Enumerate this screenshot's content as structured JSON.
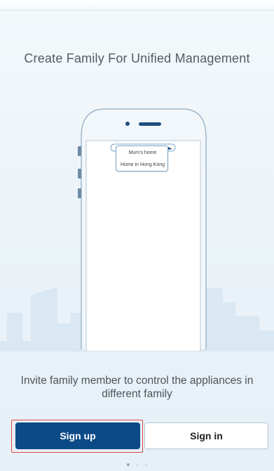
{
  "onboarding": {
    "headline": "Create Family For Unified Management",
    "popup_items": [
      "Mum's home",
      "Home in Hong Kong"
    ],
    "caption": "Invite family member to control the appliances in different family",
    "sign_up_label": "Sign up",
    "sign_in_label": "Sign in",
    "pager": {
      "count": 3,
      "active_index": 0
    }
  },
  "colors": {
    "primary_button": "#0b4a87",
    "focus_ring": "#e14a4a",
    "skyline": "#d9e8f3",
    "phone_outline": "#9fb7cb"
  },
  "icons": [
    "phone-speaker-icon",
    "phone-camera-icon",
    "popup-pointer-icon"
  ]
}
